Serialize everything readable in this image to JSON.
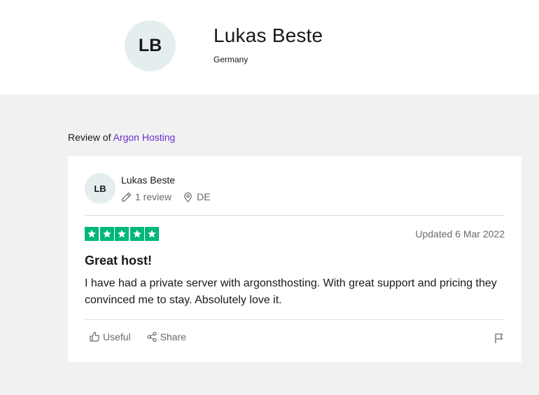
{
  "profile": {
    "initials": "LB",
    "name": "Lukas Beste",
    "country": "Germany"
  },
  "review_of": {
    "prefix": "Review of",
    "company": "Argon Hosting"
  },
  "review": {
    "reviewer_initials": "LB",
    "reviewer_name": "Lukas Beste",
    "review_count": "1 review",
    "country_code": "DE",
    "rating": 5,
    "updated": "Updated 6 Mar 2022",
    "title": "Great host!",
    "body": "I have had a private server with argonsthosting. With great support and pricing they convinced me to stay. Absolutely love it.",
    "actions": {
      "useful_label": "Useful",
      "share_label": "Share"
    }
  },
  "colors": {
    "star_green": "#00b67a",
    "link_purple": "#6a2ec9",
    "muted_text": "#696a6a",
    "avatar_bg": "#e4eeee"
  },
  "icons": [
    "pencil-icon",
    "location-pin-icon",
    "star-icon",
    "thumbs-up-icon",
    "share-icon",
    "flag-icon"
  ]
}
